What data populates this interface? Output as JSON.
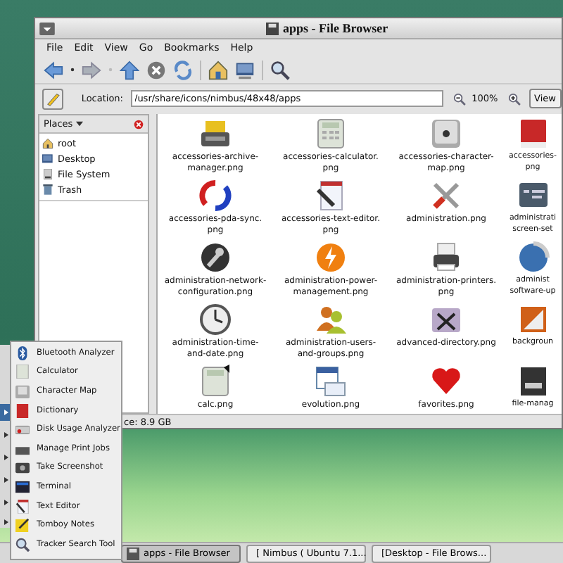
{
  "window": {
    "title": "apps - File Browser"
  },
  "menu": [
    "File",
    "Edit",
    "View",
    "Go",
    "Bookmarks",
    "Help"
  ],
  "location": {
    "label": "Location:",
    "value": "/usr/share/icons/nimbus/48x48/apps",
    "zoom": "100%",
    "view_button": "View"
  },
  "sidebar": {
    "title": "Places",
    "items": [
      {
        "label": "root"
      },
      {
        "label": "Desktop"
      },
      {
        "label": "File System"
      },
      {
        "label": "Trash"
      }
    ]
  },
  "files": [
    {
      "name": "accessories-archive-\nmanager.png"
    },
    {
      "name": "accessories-calculator.\npng"
    },
    {
      "name": "accessories-character-\nmap.png"
    },
    {
      "name": "accessories-\npng"
    },
    {
      "name": "accessories-pda-sync.\npng"
    },
    {
      "name": "accessories-text-editor.\npng"
    },
    {
      "name": "administration.png"
    },
    {
      "name": "administrati\nscreen-set"
    },
    {
      "name": "administration-network-\nconfiguration.png"
    },
    {
      "name": "administration-power-\nmanagement.png"
    },
    {
      "name": "administration-printers.\npng"
    },
    {
      "name": "administ\nsoftware-up"
    },
    {
      "name": "administration-time-\nand-date.png"
    },
    {
      "name": "administration-users-\nand-groups.png"
    },
    {
      "name": "advanced-directory.png"
    },
    {
      "name": "backgroun"
    },
    {
      "name": "calc.png"
    },
    {
      "name": "evolution.png"
    },
    {
      "name": "favorites.png"
    },
    {
      "name": "file-manag"
    }
  ],
  "status_bar": "ce: 8.9 GB",
  "popup_menu": [
    "Bluetooth Analyzer",
    "Calculator",
    "Character Map",
    "Dictionary",
    "Disk Usage Analyzer",
    "Manage Print Jobs",
    "Take Screenshot",
    "Terminal",
    "Text Editor",
    "Tomboy Notes",
    "Tracker Search Tool"
  ],
  "taskbar": [
    {
      "label": "apps - File Browser",
      "selected": true
    },
    {
      "label": "[ Nimbus ( Ubuntu 7.1...",
      "selected": false
    },
    {
      "label": "[Desktop - File Brows...",
      "selected": false
    }
  ]
}
